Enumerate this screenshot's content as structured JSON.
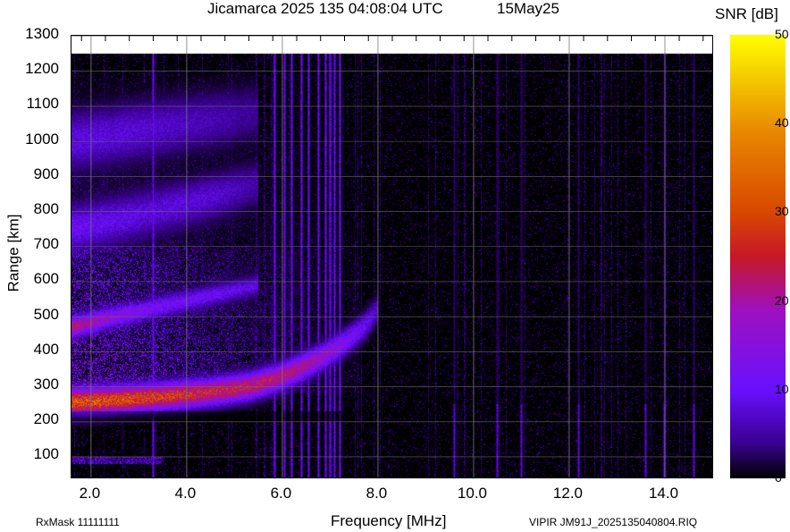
{
  "chart_data": {
    "type": "heatmap",
    "title": "Jicamarca 2025 135 04:08:04 UTC",
    "date_label": "15May25",
    "xlabel": "Frequency [MHz]",
    "ylabel": "Range [km]",
    "colorbar_label": "SNR [dB]",
    "xlim": [
      1.6,
      15.0
    ],
    "ylim": [
      40,
      1300
    ],
    "data_top_range_km": 1250,
    "x_ticks": [
      "2.0",
      "4.0",
      "6.0",
      "8.0",
      "10.0",
      "12.0",
      "14.0"
    ],
    "x_tick_values": [
      2,
      4,
      6,
      8,
      10,
      12,
      14
    ],
    "y_ticks": [
      "1300",
      "1200",
      "1100",
      "1000",
      "900",
      "800",
      "700",
      "600",
      "500",
      "400",
      "300",
      "200",
      "100"
    ],
    "y_tick_values": [
      1300,
      1200,
      1100,
      1000,
      900,
      800,
      700,
      600,
      500,
      400,
      300,
      200,
      100
    ],
    "colorbar_ticks": [
      "50",
      "40",
      "30",
      "20",
      "10",
      "0"
    ],
    "colorbar_tick_values": [
      50,
      40,
      30,
      20,
      10,
      0
    ],
    "clim": [
      0,
      50
    ],
    "colormap": [
      "#000000",
      "#3a0090",
      "#6a10ff",
      "#a010c0",
      "#c81828",
      "#d84800",
      "#e88800",
      "#ffff00"
    ],
    "grid": true,
    "traces": [
      {
        "name": "F-layer echo",
        "freq": [
          1.6,
          2.5,
          3.5,
          4.5,
          5.3,
          5.9,
          6.4,
          6.9,
          7.3,
          7.7,
          8.0
        ],
        "range": [
          255,
          262,
          272,
          285,
          300,
          325,
          355,
          390,
          425,
          470,
          520
        ],
        "snr": [
          38,
          36,
          33,
          30,
          28,
          26,
          24,
          20,
          16,
          12,
          8
        ],
        "width_km": 45
      },
      {
        "name": "second hop",
        "freq": [
          1.6,
          2.5,
          3.5,
          4.5,
          5.5
        ],
        "range": [
          470,
          500,
          530,
          560,
          590
        ],
        "snr": [
          26,
          18,
          14,
          12,
          10
        ],
        "width_km": 35
      },
      {
        "name": "diffuse band",
        "freq": [
          1.6,
          3.0,
          4.5,
          5.5
        ],
        "range": [
          750,
          790,
          840,
          880
        ],
        "snr": [
          12,
          10,
          9,
          6
        ],
        "width_km": 80
      },
      {
        "name": "upper diffuse",
        "freq": [
          1.6,
          3.0,
          4.5,
          5.5
        ],
        "range": [
          1000,
          1030,
          1060,
          1080
        ],
        "snr": [
          10,
          9,
          7,
          5
        ],
        "width_km": 100
      }
    ],
    "interference_lines_mhz": [
      3.3,
      5.85,
      6.05,
      6.2,
      6.4,
      6.55,
      6.75,
      6.9,
      7.0,
      7.1,
      7.2,
      9.6,
      10.5,
      11.0,
      12.2,
      13.6,
      14.0,
      14.6
    ]
  },
  "footer": {
    "rxmask": "RxMask 11111111",
    "filename": "VIPIR  JM91J_2025135040804.RIQ"
  }
}
